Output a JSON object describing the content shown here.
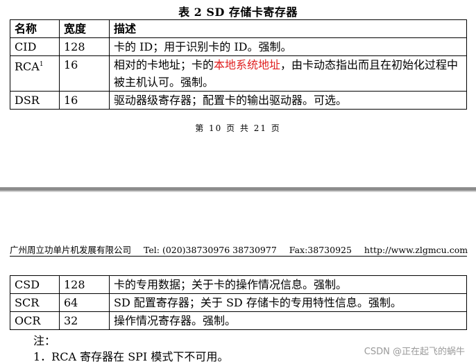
{
  "table_title": "表 2    SD 存储卡寄存器",
  "table1": {
    "headers": [
      "名称",
      "宽度",
      "描述"
    ],
    "rows": [
      {
        "name": "CID",
        "width": "128",
        "desc": "卡的 ID；用于识别卡的 ID。强制。"
      },
      {
        "name": "RCA",
        "name_sup": "1",
        "width": "16",
        "desc_before": "相对的卡地址；卡的",
        "desc_highlight": "本地系统地址",
        "desc_after": "，由卡动态指出而且在初始化过程中被主机认可。强制。"
      },
      {
        "name": "DSR",
        "width": "16",
        "desc": "驱动器级寄存器；配置卡的输出驱动器。可选。"
      }
    ]
  },
  "page_footer": "第 10 页 共 21 页",
  "header_info": {
    "company": "广州周立功单片机发展有限公司",
    "tel": "Tel: (020)38730976    38730977",
    "fax": "Fax:38730925",
    "url": "http://www.zlgmcu.com"
  },
  "table2": {
    "rows": [
      {
        "name": "CSD",
        "width": "128",
        "desc": "卡的专用数据；关于卡的操作情况信息。强制。"
      },
      {
        "name": "SCR",
        "width": "64",
        "desc": "SD 配置寄存器；关于 SD 存储卡的专用特性信息。强制。"
      },
      {
        "name": "OCR",
        "width": "32",
        "desc": "操作情况寄存器。强制。"
      }
    ]
  },
  "notes": {
    "label": "注：",
    "items": [
      "1．RCA 寄存器在 SPI 模式下不可用。"
    ]
  },
  "watermark": "CSDN @正在起飞的蜗牛",
  "colors": {
    "highlight": "#e02020",
    "separator": "#8c8c8c"
  }
}
